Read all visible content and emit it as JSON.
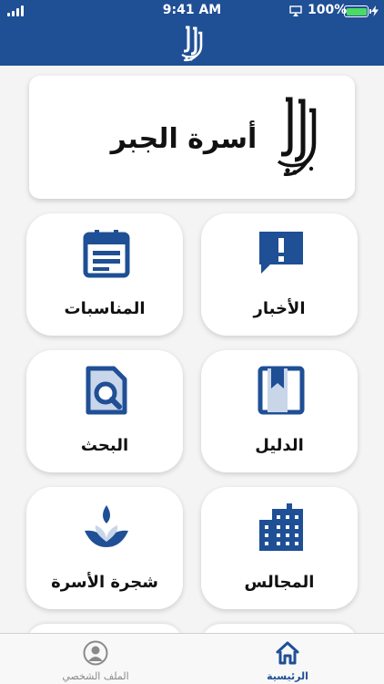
{
  "status_bar": {
    "time": "9:41 AM",
    "battery": "100%"
  },
  "banner": {
    "title": "أسرة الجبر"
  },
  "tiles": [
    {
      "label": "الأخبار",
      "icon": "news-alert-icon"
    },
    {
      "label": "المناسبات",
      "icon": "calendar-icon"
    },
    {
      "label": "الدليل",
      "icon": "bookmark-book-icon"
    },
    {
      "label": "البحث",
      "icon": "search-document-icon"
    },
    {
      "label": "المجالس",
      "icon": "building-icon"
    },
    {
      "label": "شجرة الأسرة",
      "icon": "plant-icon"
    }
  ],
  "tab_bar": {
    "home": {
      "label": "الرئيسية",
      "icon": "home-icon",
      "active": true
    },
    "profile": {
      "label": "الملف الشخصي",
      "icon": "user-icon",
      "active": false
    }
  },
  "colors": {
    "primary": "#1f4f95",
    "active_tab": "#1f4f95",
    "inactive_tab": "#8a8a8a",
    "battery": "#4cd964"
  }
}
